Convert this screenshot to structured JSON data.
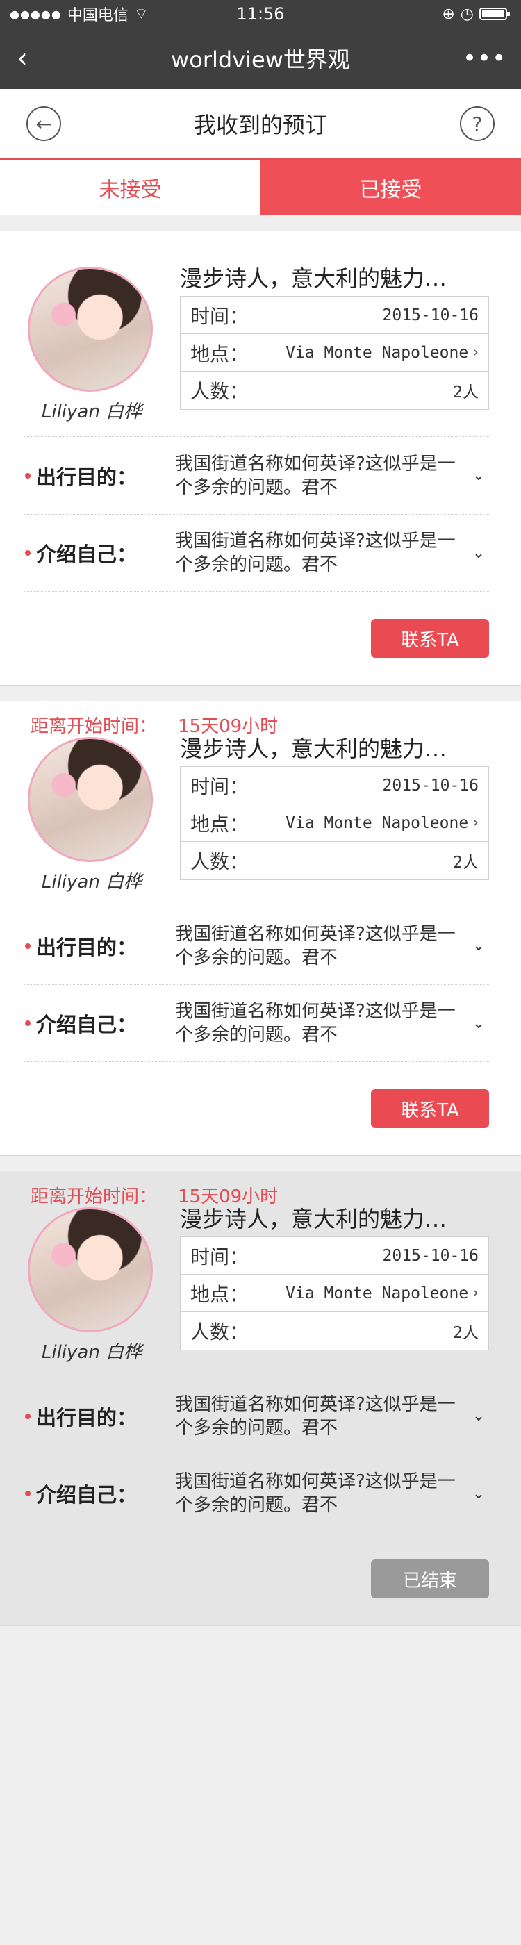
{
  "status_bar": {
    "carrier": "中国电信",
    "time": "11:56"
  },
  "nav": {
    "title": "worldview世界观"
  },
  "page": {
    "title": "我收到的预订"
  },
  "tabs": [
    {
      "label": "未接受",
      "active": false
    },
    {
      "label": "已接受",
      "active": true
    }
  ],
  "cards": [
    {
      "countdown_label": "",
      "countdown_value": "",
      "name": "Liliyan 白桦",
      "title": "漫步诗人，意大利的魅力…",
      "time_label": "时间：",
      "time_value": "2015-10-16",
      "place_label": "地点：",
      "place_value": "Via Monte Napoleone",
      "people_label": "人数：",
      "people_value": "2人",
      "purpose_label": "出行目的：",
      "purpose_text": "我国街道名称如何英译?这似乎是一个多余的问题。君不",
      "intro_label": "介绍自己：",
      "intro_text": "我国街道名称如何英译?这似乎是一个多余的问题。君不",
      "button_label": "联系TA",
      "ended": false
    },
    {
      "countdown_label": "距离开始时间：",
      "countdown_value": "15天09小时",
      "name": "Liliyan 白桦",
      "title": "漫步诗人，意大利的魅力…",
      "time_label": "时间：",
      "time_value": "2015-10-16",
      "place_label": "地点：",
      "place_value": "Via Monte Napoleone",
      "people_label": "人数：",
      "people_value": "2人",
      "purpose_label": "出行目的：",
      "purpose_text": "我国街道名称如何英译?这似乎是一个多余的问题。君不",
      "intro_label": "介绍自己：",
      "intro_text": "我国街道名称如何英译?这似乎是一个多余的问题。君不",
      "button_label": "联系TA",
      "ended": false
    },
    {
      "countdown_label": "距离开始时间：",
      "countdown_value": "15天09小时",
      "name": "Liliyan 白桦",
      "title": "漫步诗人，意大利的魅力…",
      "time_label": "时间：",
      "time_value": "2015-10-16",
      "place_label": "地点：",
      "place_value": "Via Monte Napoleone",
      "people_label": "人数：",
      "people_value": "2人",
      "purpose_label": "出行目的：",
      "purpose_text": "我国街道名称如何英译?这似乎是一个多余的问题。君不",
      "intro_label": "介绍自己：",
      "intro_text": "我国街道名称如何英译?这似乎是一个多余的问题。君不",
      "button_label": "已结束",
      "ended": true
    }
  ]
}
